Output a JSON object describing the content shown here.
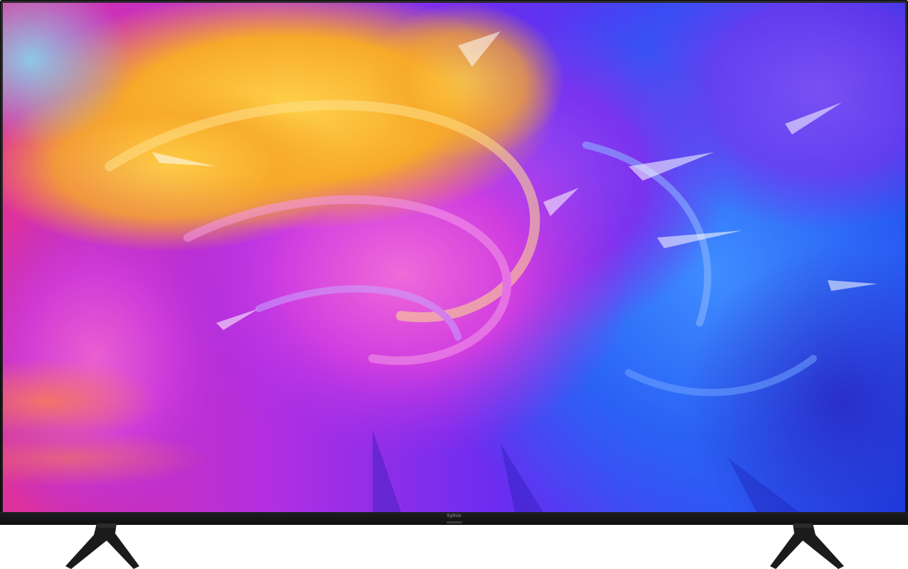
{
  "product": {
    "brand_label": "Sylnix"
  },
  "colors": {
    "bezel": "#1a1a1b",
    "stand": "#1b1b1c",
    "wallpaper_yellow": "#f7b52a",
    "wallpaper_magenta": "#c235d8",
    "wallpaper_purple": "#7b2cf0",
    "wallpaper_blue": "#2a5ef5"
  }
}
